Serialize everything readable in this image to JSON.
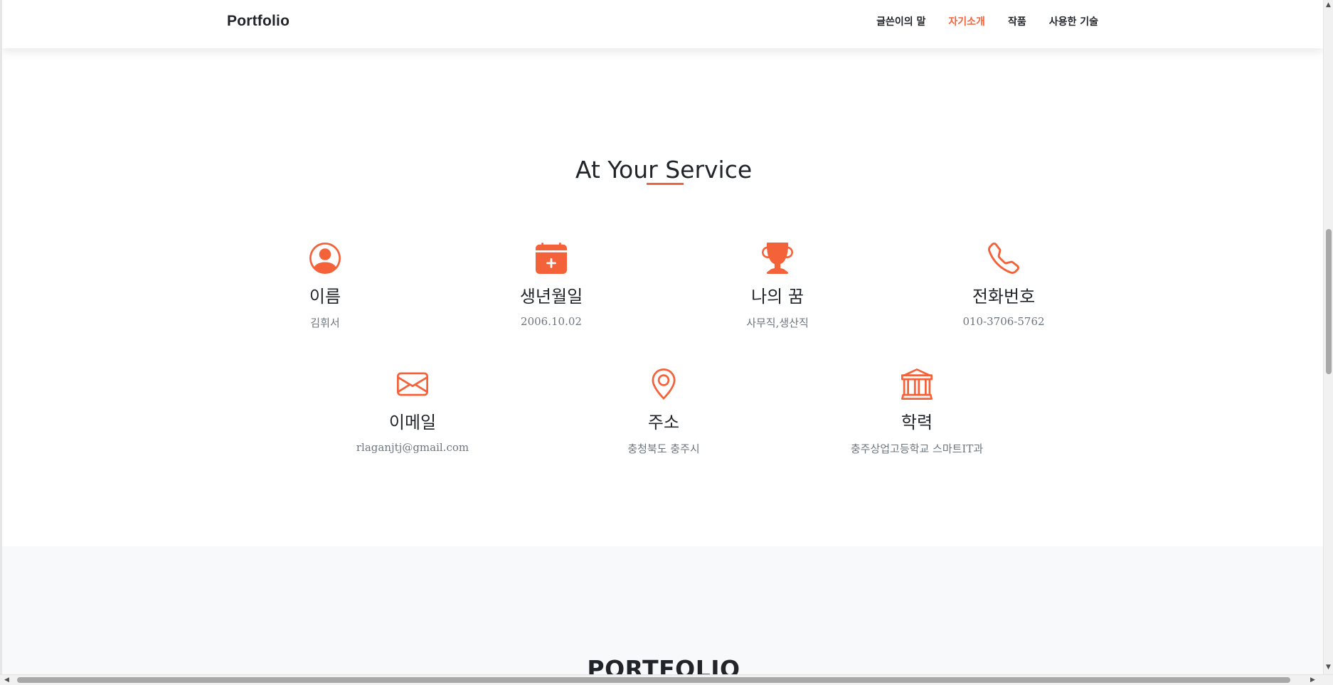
{
  "navbar": {
    "brand": "Portfolio",
    "links": [
      {
        "label": "글쓴이의 말",
        "active": false
      },
      {
        "label": "자기소개",
        "active": true
      },
      {
        "label": "작품",
        "active": false
      },
      {
        "label": "사용한 기술",
        "active": false
      }
    ]
  },
  "about": {
    "title": "At Your Service",
    "accent_color": "#f4623a",
    "items": [
      {
        "icon": "person-circle-icon",
        "label": "이름",
        "value": "김휘서"
      },
      {
        "icon": "calendar-plus-icon",
        "label": "생년월일",
        "value": "2006.10.02"
      },
      {
        "icon": "trophy-icon",
        "label": "나의 꿈",
        "value": "사무직,생산직"
      },
      {
        "icon": "telephone-icon",
        "label": "전화번호",
        "value": "010-3706-5762"
      },
      {
        "icon": "envelope-icon",
        "label": "이메일",
        "value": "rlaganjtj@gmail.com"
      },
      {
        "icon": "geo-pin-icon",
        "label": "주소",
        "value": "충청북도 충주시"
      },
      {
        "icon": "bank-icon",
        "label": "학력",
        "value": "충주상업고등학교 스마트IT과"
      }
    ]
  },
  "portfolio": {
    "title": "PORTFOLIO"
  }
}
